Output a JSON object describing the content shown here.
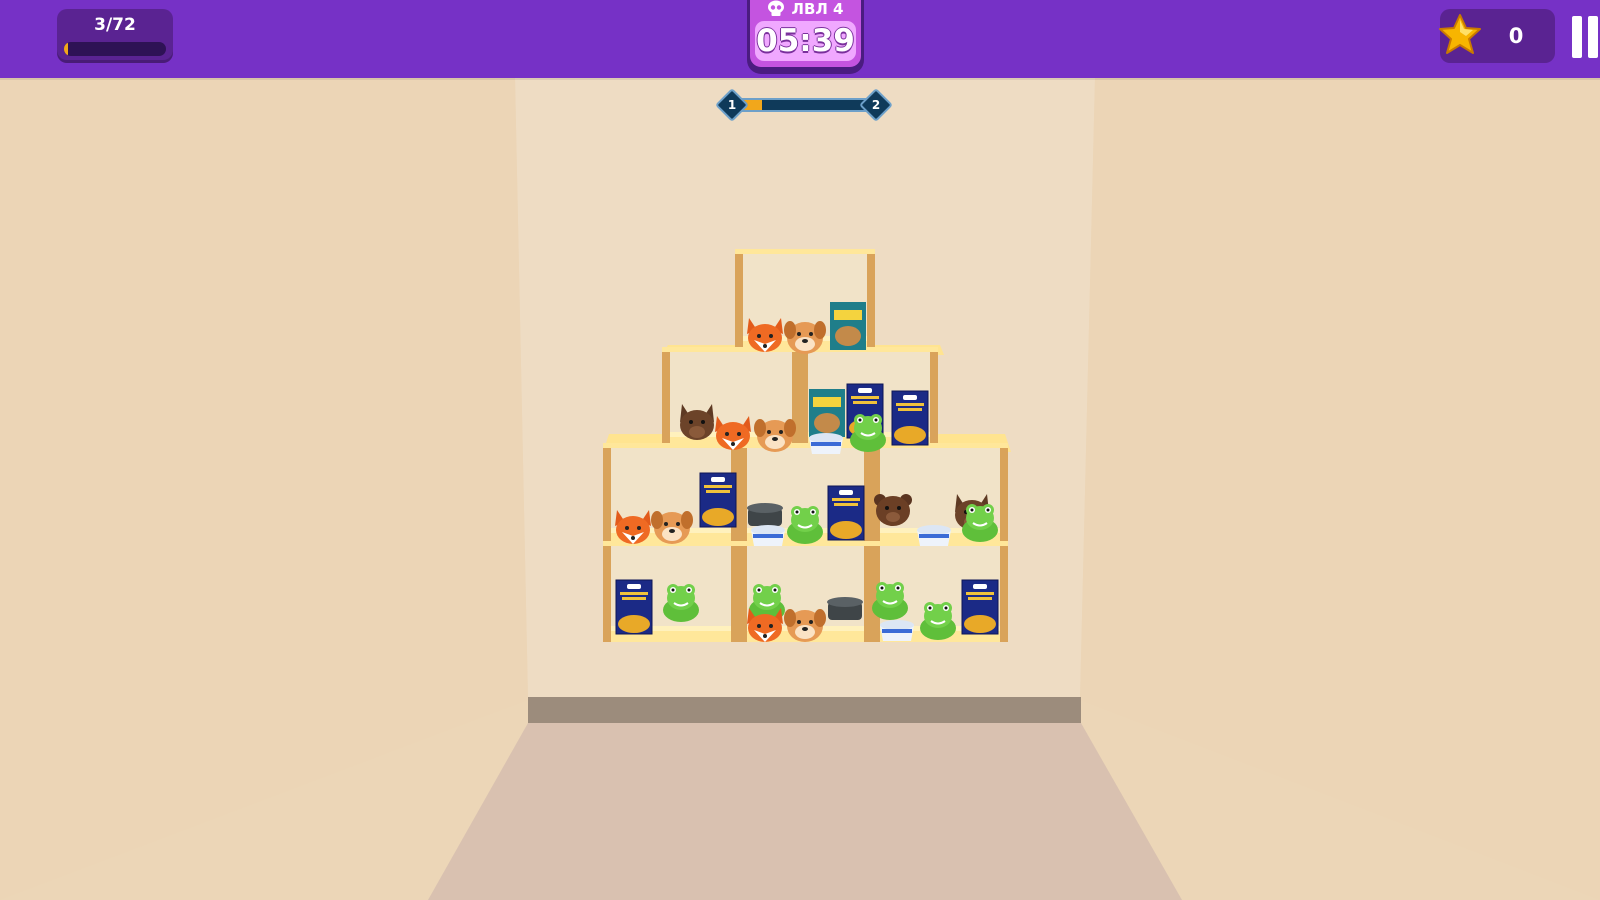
{
  "hud": {
    "progress_text": "3/72",
    "progress_fraction": 0.042,
    "level_label": "ЛВЛ 4",
    "timer": "05:39",
    "star_count": "0"
  },
  "stage_progress": {
    "from_label": "1",
    "to_label": "2",
    "fraction": 0.18
  },
  "colors": {
    "topbar": "#7631c6",
    "panel": "#5a2392",
    "accent_orange": "#f2a71b",
    "timer_bg": "#c454e0",
    "wall": "#ecd6b7",
    "back_wall": "#eadac6",
    "floor": "#d9c0b0",
    "shelf_wood": "#ffe79a"
  },
  "icons": {
    "level_icon": "skull-icon",
    "currency_icon": "star-icon",
    "pause_icon": "pause-icon"
  },
  "shelf_items": [
    {
      "cell": "top",
      "items": [
        "fox-head",
        "dog-head",
        "cereal-box"
      ]
    },
    {
      "cell": "row2-left",
      "items": [
        "wolf-head",
        "fox-head",
        "dog-head"
      ]
    },
    {
      "cell": "row2-right",
      "items": [
        "cereal-box",
        "macaroni-box",
        "yogurt-cup",
        "frog-toy",
        "macaroni-box"
      ]
    },
    {
      "cell": "row3-left",
      "items": [
        "fox-head",
        "dog-head",
        "macaroni-box"
      ]
    },
    {
      "cell": "row3-mid",
      "items": [
        "cooking-pot",
        "yogurt-cup",
        "frog-toy",
        "macaroni-box"
      ]
    },
    {
      "cell": "row3-right",
      "items": [
        "bear-head",
        "yogurt-cup",
        "wolf-head",
        "frog-toy"
      ]
    },
    {
      "cell": "row4-left",
      "items": [
        "macaroni-box",
        "frog-toy"
      ]
    },
    {
      "cell": "row4-mid",
      "items": [
        "frog-toy",
        "fox-head",
        "dog-head",
        "cooking-pot"
      ]
    },
    {
      "cell": "row4-right",
      "items": [
        "frog-toy",
        "yogurt-cup",
        "frog-toy",
        "macaroni-box"
      ]
    }
  ]
}
